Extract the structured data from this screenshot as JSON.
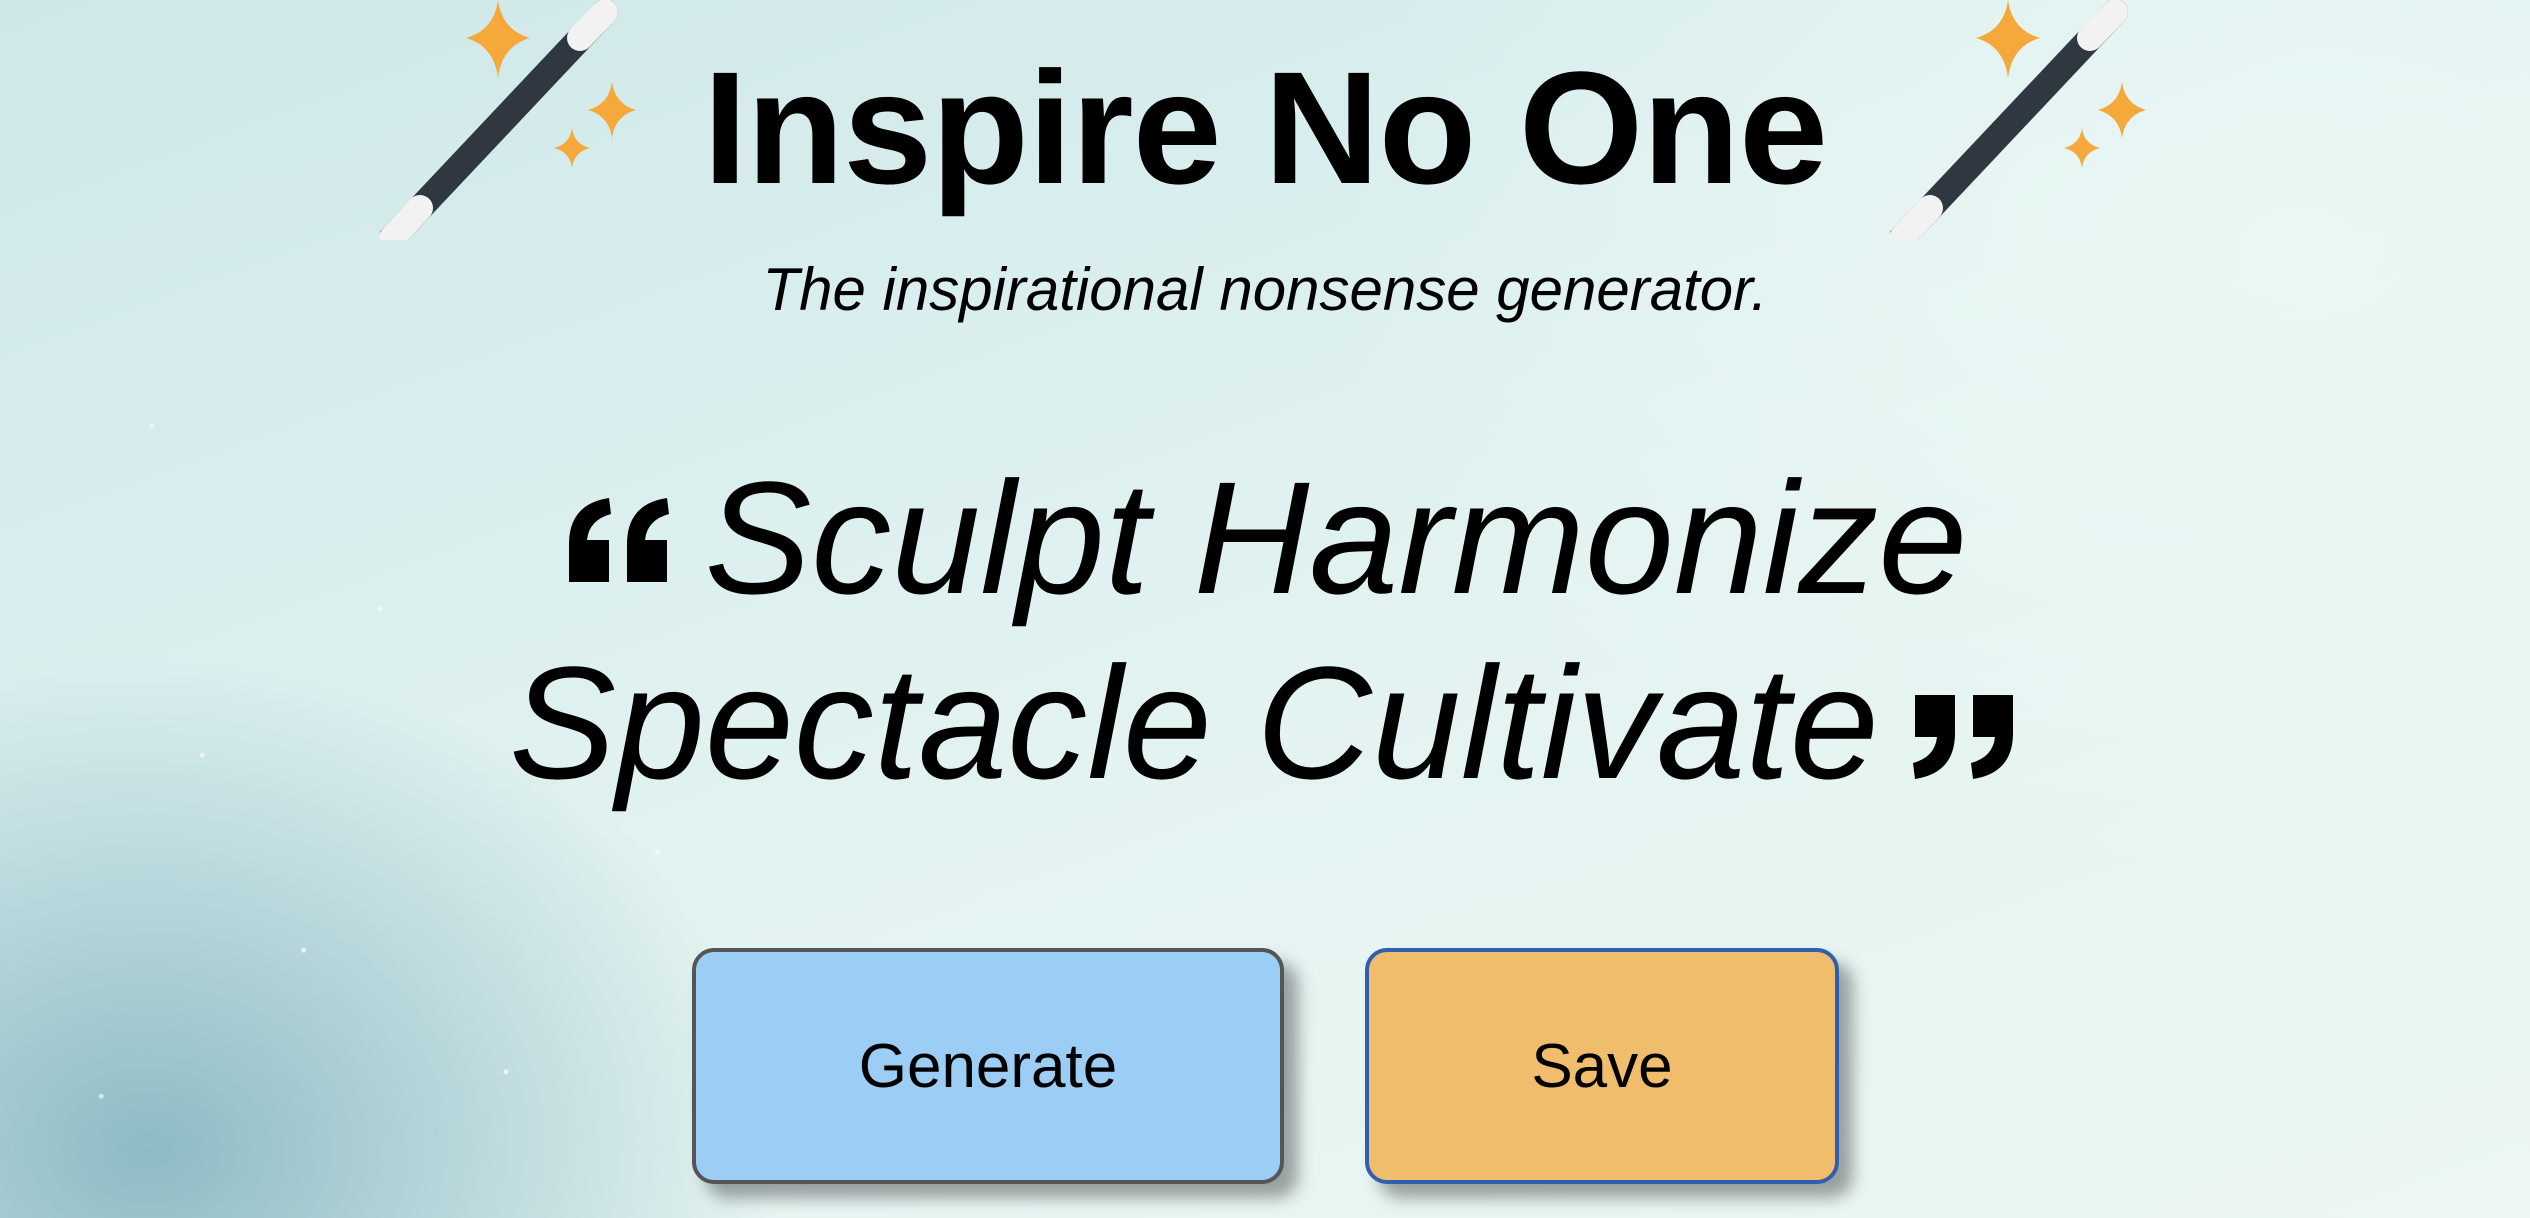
{
  "header": {
    "title": "Inspire No One",
    "subtitle": "The inspirational nonsense generator.",
    "left_icon": "magic-wand-icon",
    "right_icon": "magic-wand-icon"
  },
  "quote": {
    "text": "Sculpt Harmonize Spectacle Cultivate",
    "open_icon": "open-quote-icon",
    "close_icon": "close-quote-icon"
  },
  "actions": {
    "generate_label": "Generate",
    "save_label": "Save"
  },
  "colors": {
    "generate_bg": "#9ccdf4",
    "save_bg": "#efbd6c",
    "sparkle": "#f5a93b",
    "wand": "#2f3840"
  }
}
